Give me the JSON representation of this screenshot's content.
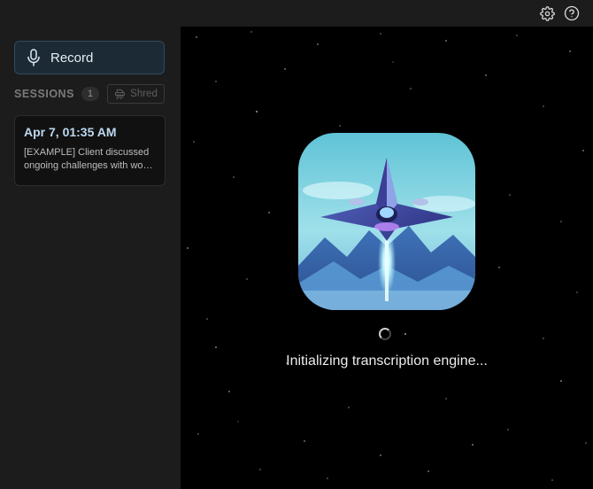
{
  "titlebar": {
    "icons": [
      "gear-icon",
      "help-icon"
    ]
  },
  "sidebar": {
    "record_label": "Record",
    "sessions_label": "SESSIONS",
    "sessions_count": "1",
    "shred_label": "Shred",
    "sessions": [
      {
        "date": "Apr 7, 01:35 AM",
        "summary": "[EXAMPLE] Client discussed ongoing challenges with work and stress"
      }
    ]
  },
  "main": {
    "logo_icon": "spaceship-logo-icon",
    "status_text": "Initializing transcription engine..."
  },
  "colors": {
    "accent_record_bg": "#1c2a36",
    "accent_record_border": "#2f4b60",
    "session_date": "#bcd8f0"
  }
}
